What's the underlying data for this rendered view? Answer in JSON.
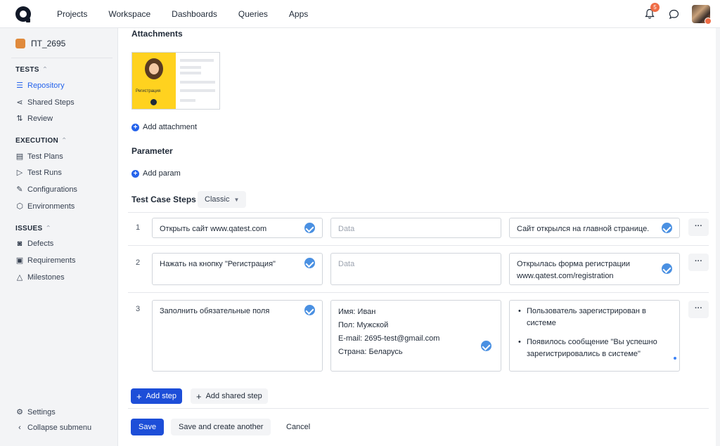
{
  "topbar": {
    "nav": [
      "Projects",
      "Workspace",
      "Dashboards",
      "Queries",
      "Apps"
    ],
    "notifications_count": "5"
  },
  "sidebar": {
    "project_name": "ПТ_2695",
    "sections": {
      "tests": "TESTS",
      "execution": "EXECUTION",
      "issues": "ISSUES"
    },
    "items": {
      "repository": "Repository",
      "shared_steps": "Shared Steps",
      "review": "Review",
      "test_plans": "Test Plans",
      "test_runs": "Test Runs",
      "configurations": "Configurations",
      "environments": "Environments",
      "defects": "Defects",
      "requirements": "Requirements",
      "milestones": "Milestones"
    },
    "settings": "Settings",
    "collapse": "Collapse submenu"
  },
  "main": {
    "attachments_title": "Attachments",
    "thumbnail_caption": "Регистрация",
    "add_attachment": "Add attachment",
    "parameter_title": "Parameter",
    "add_param": "Add param",
    "steps_title": "Test Case Steps",
    "steps_mode": "Classic",
    "steps": [
      {
        "num": "1",
        "action": "Открыть сайт www.qatest.com",
        "data_placeholder": "Data",
        "expected": "Сайт открылся на главной странице."
      },
      {
        "num": "2",
        "action": "Нажать на кнопку \"Регистрация\"",
        "data_placeholder": "Data",
        "expected_line1": "Открылась форма регистрации",
        "expected_line2": "www.qatest.com/registration"
      },
      {
        "num": "3",
        "action": "Заполнить обязательные поля",
        "data_lines": [
          "Имя: Иван",
          "Пол: Мужской",
          "E-mail: 2695-test@gmail.com",
          "Страна: Беларусь"
        ],
        "expected_items": [
          "Пользователь зарегистрирован в системе",
          "Появилось сообщение \"Вы успешно зарегистрировались в системе\""
        ]
      }
    ],
    "more_label": "···",
    "add_step": "Add step",
    "add_shared_step": "Add shared step",
    "save": "Save",
    "save_and_create": "Save and create another",
    "cancel": "Cancel"
  }
}
